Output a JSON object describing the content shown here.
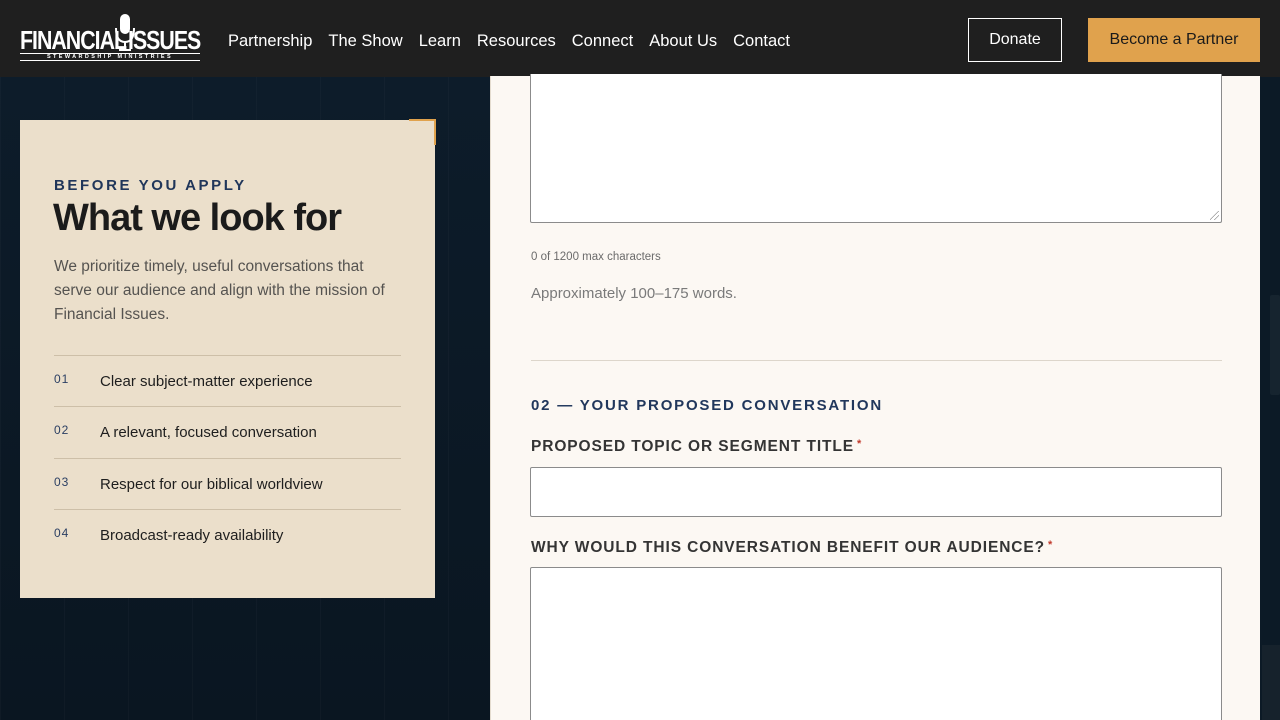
{
  "header": {
    "logo": {
      "word1": "FINANCIAL",
      "word2": "ISSUES",
      "tagline": "STEWARDSHIP MINISTRIES"
    },
    "nav": [
      "Partnership",
      "The Show",
      "Learn",
      "Resources",
      "Connect",
      "About Us",
      "Contact"
    ],
    "donate_label": "Donate",
    "partner_label": "Become a Partner"
  },
  "card": {
    "eyebrow": "BEFORE YOU APPLY",
    "title": "What we look for",
    "intro": "We prioritize timely, useful conversations that serve our audience and align with the mission of Financial Issues.",
    "criteria": [
      {
        "num": "01",
        "text": "Clear subject-matter experience"
      },
      {
        "num": "02",
        "text": "A relevant, focused conversation"
      },
      {
        "num": "03",
        "text": "Respect for our biblical worldview"
      },
      {
        "num": "04",
        "text": "Broadcast-ready availability"
      }
    ]
  },
  "form": {
    "char_count": "0 of 1200 max characters",
    "help_text": "Approximately 100–175 words.",
    "section_title": "02 — YOUR PROPOSED CONVERSATION",
    "topic_label": "PROPOSED TOPIC OR SEGMENT TITLE",
    "why_label": "WHY WOULD THIS CONVERSATION BENEFIT OUR AUDIENCE?",
    "required_mark": "*",
    "topic_value": "",
    "why_value": ""
  },
  "colors": {
    "header_bg": "#1f1f1f",
    "accent": "#e0a24d",
    "card_bg": "#ebdfcb",
    "navy": "#20365a",
    "page_bg": "#0c1a26",
    "form_bg": "#fcf8f3"
  }
}
